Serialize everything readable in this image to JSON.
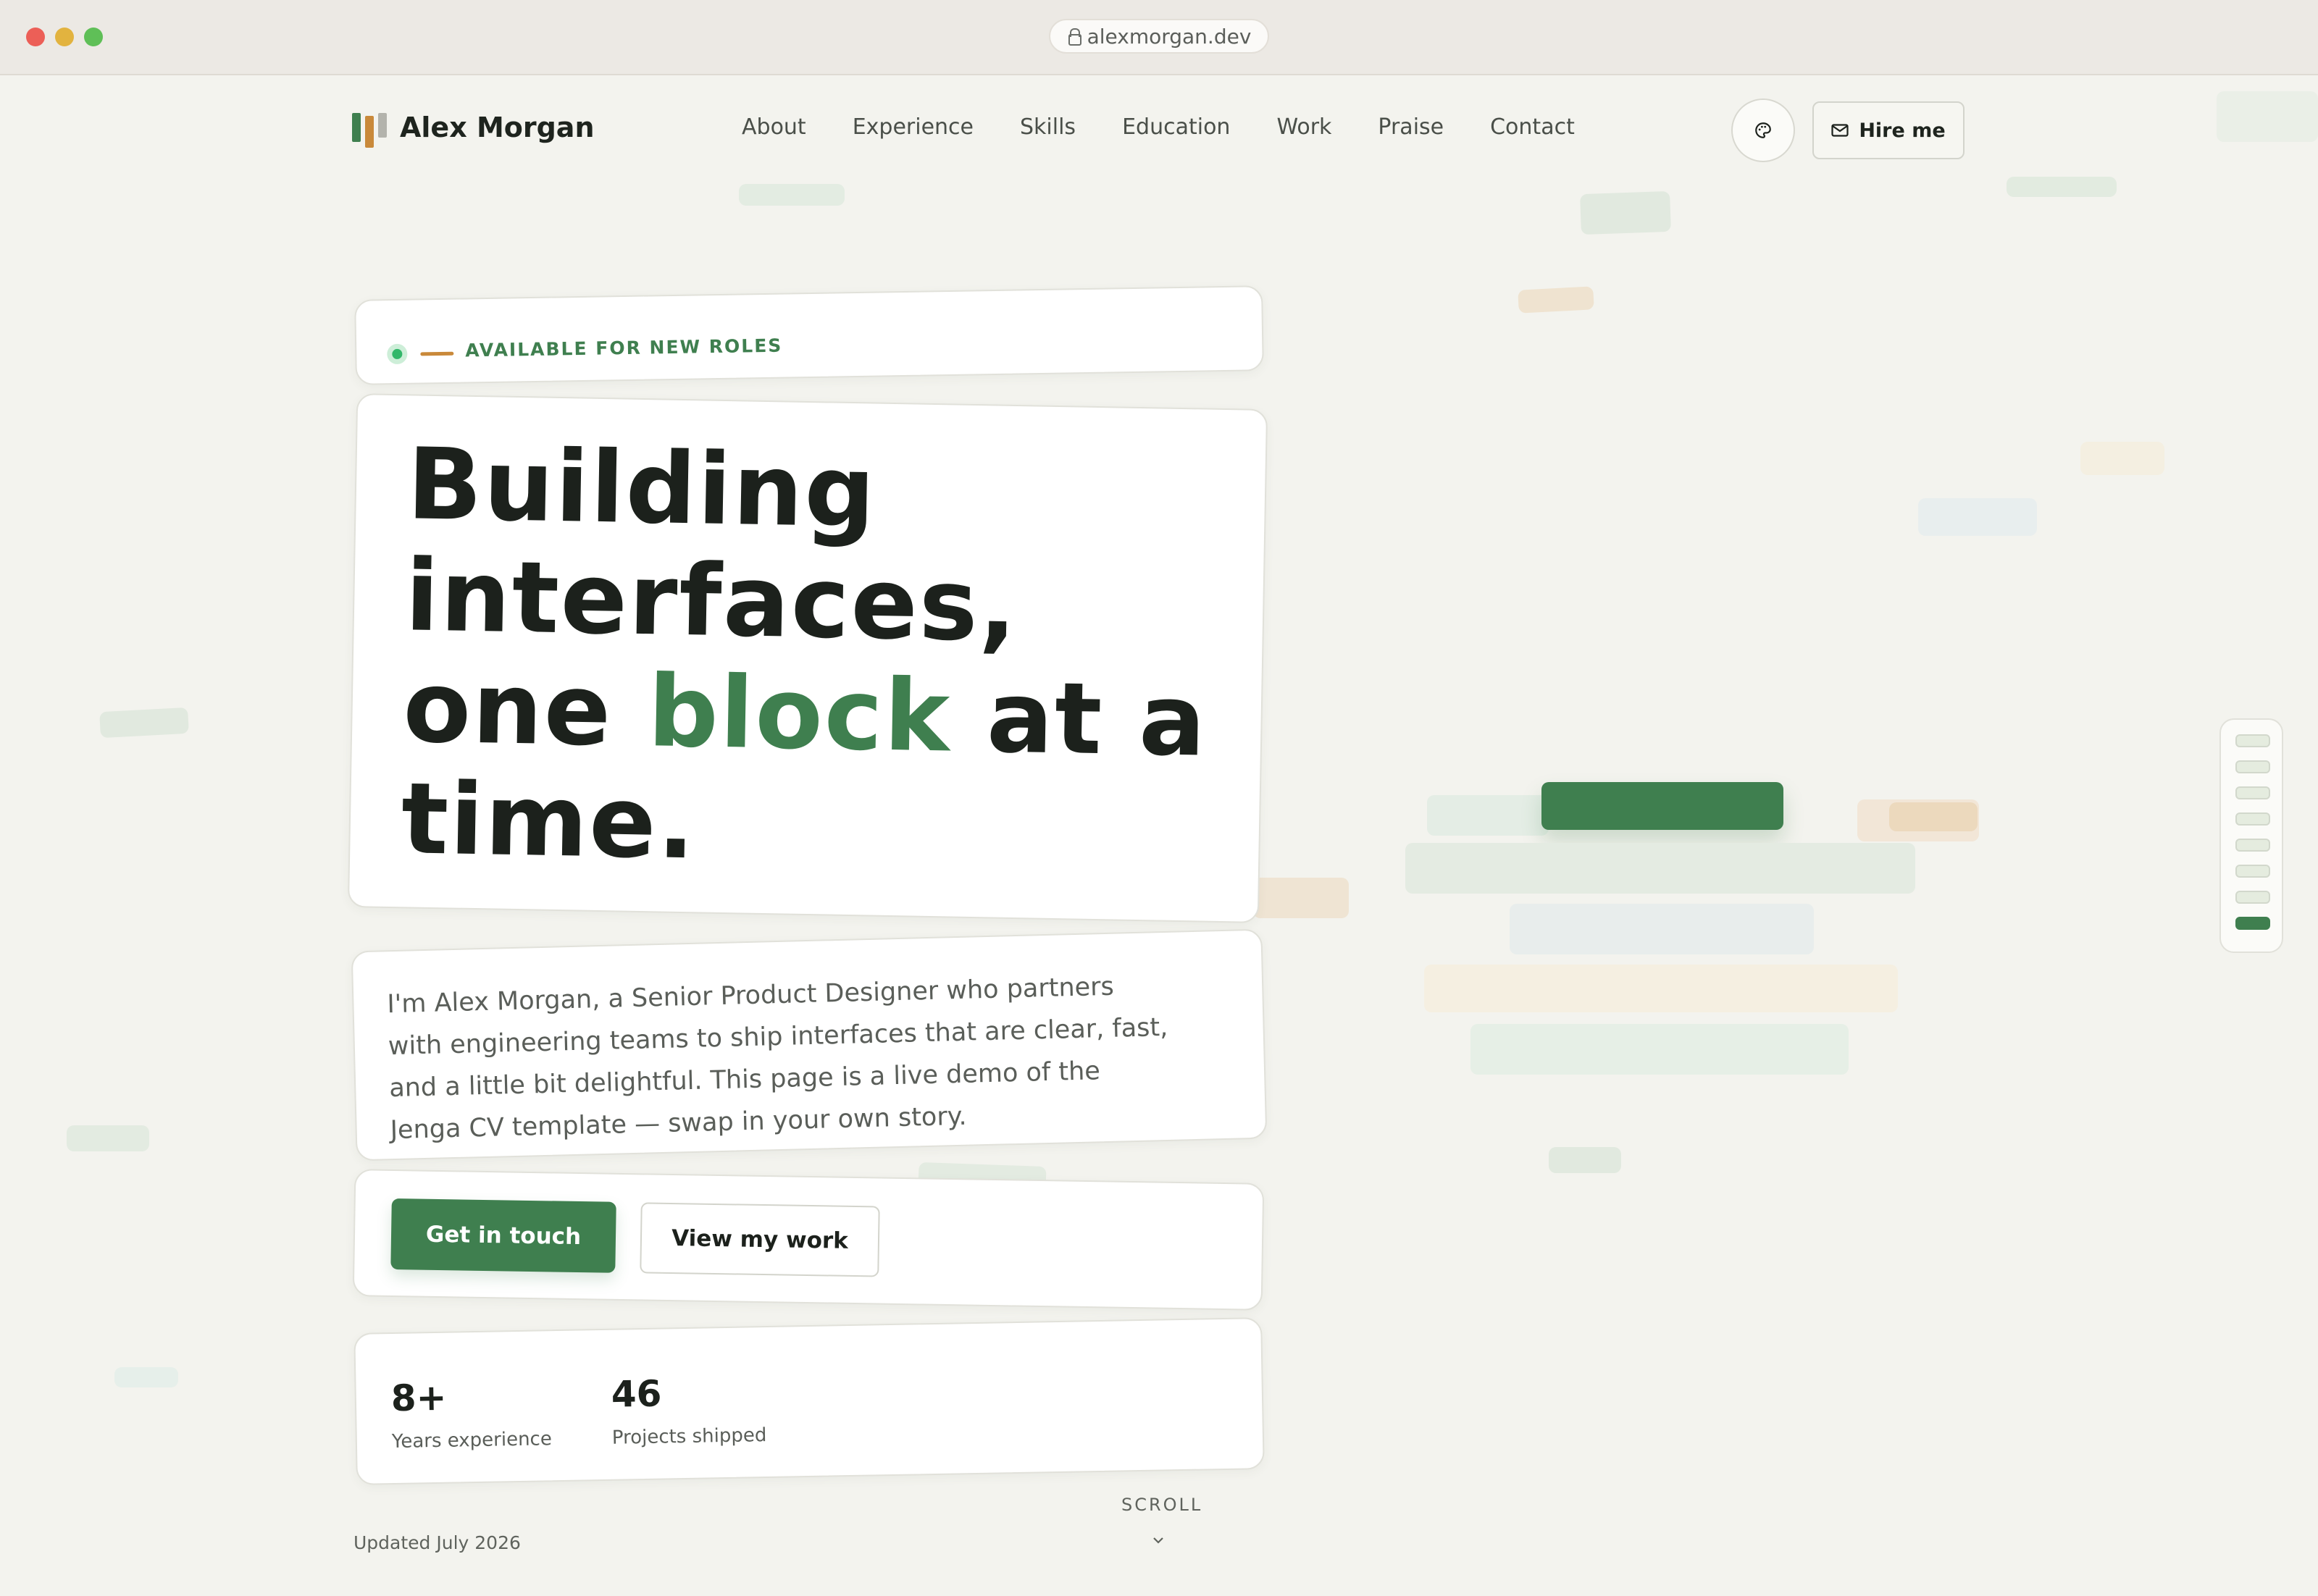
{
  "browser": {
    "url": "alexmorgan.dev"
  },
  "nav": {
    "brand": "Alex Morgan",
    "items": [
      "About",
      "Experience",
      "Skills",
      "Education",
      "Work",
      "Praise",
      "Contact"
    ],
    "hire_label": "Hire me",
    "icons": {
      "theme": "palette-icon",
      "hire": "mail-icon"
    }
  },
  "hero": {
    "badge": "AVAILABLE FOR NEW ROLES",
    "headline_l1": "Building",
    "headline_l2": "interfaces,",
    "headline_pre": "one",
    "headline_accent": "block",
    "headline_post": "at a",
    "headline_l4": "time.",
    "intro": "I'm Alex Morgan, a Senior Product Designer who partners with engineering teams to ship interfaces that are clear, fast, and a little bit delightful. This page is a live demo of the Jenga CV template — swap in your own story.",
    "primary_cta": "Get in touch",
    "secondary_cta": "View my work",
    "stats": [
      {
        "value": "8+",
        "label": "Years experience"
      },
      {
        "value": "46",
        "label": "Projects shipped"
      }
    ],
    "updated": "Updated July 2026",
    "scroll": "SCROLL"
  },
  "progress": {
    "sections": 8,
    "active_index": 7
  },
  "colors": {
    "accent": "#3f7f4f",
    "secondary": "#c9893a",
    "background": "#f3f3ee"
  }
}
